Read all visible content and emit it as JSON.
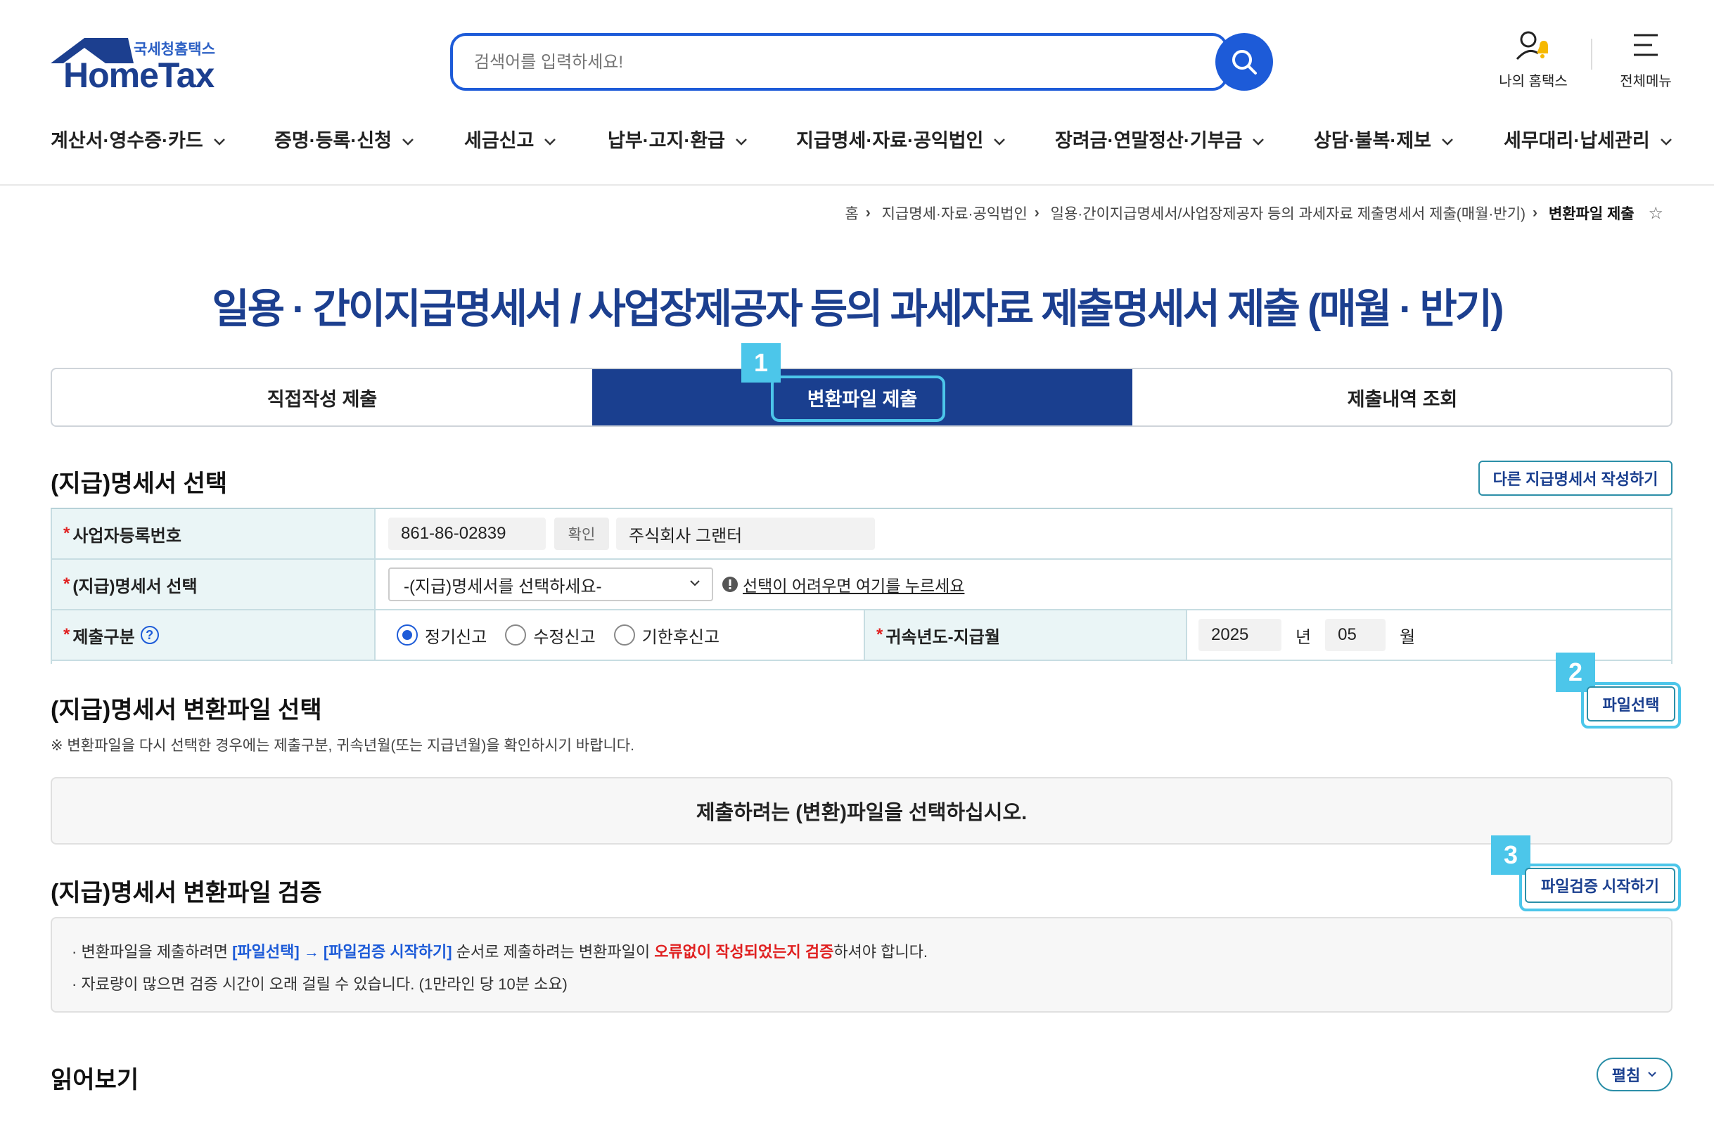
{
  "header": {
    "logo_sub": "국세청홈택스",
    "logo_main": "HomeTax",
    "search_placeholder": "검색어를 입력하세요!",
    "my_hometax": "나의 홈택스",
    "all_menu": "전체메뉴"
  },
  "gnb": [
    "계산서·영수증·카드",
    "증명·등록·신청",
    "세금신고",
    "납부·고지·환급",
    "지급명세·자료·공익법인",
    "장려금·연말정산·기부금",
    "상담·불복·제보",
    "세무대리·납세관리"
  ],
  "breadcrumb": {
    "home": "홈",
    "level1": "지급명세·자료·공익법인",
    "level2": "일용·간이지급명세서/사업장제공자 등의 과세자료 제출명세서 제출(매월·반기)",
    "current": "변환파일 제출"
  },
  "page_title": "일용 · 간이지급명세서 / 사업장제공자 등의 과세자료 제출명세서 제출 (매월 · 반기)",
  "tabs": [
    "직접작성 제출",
    "변환파일 제출",
    "제출내역 조회"
  ],
  "markers": [
    "1",
    "2",
    "3"
  ],
  "section1": {
    "title": "(지급)명세서 선택",
    "other_btn": "다른 지급명세서 작성하기",
    "biz_no_label": "사업자등록번호",
    "biz_no": "861-86-02839",
    "confirm_btn": "확인",
    "company": "주식회사 그랜터",
    "stmt_label": "(지급)명세서 선택",
    "stmt_select": "-(지급)명세서를 선택하세요-",
    "stmt_help": "선택이 어려우면 여기를 누르세요",
    "submit_type_label": "제출구분",
    "help_icon": "?",
    "radio_options": [
      "정기신고",
      "수정신고",
      "기한후신고"
    ],
    "period_label": "귀속년도-지급월",
    "year": "2025",
    "year_unit": "년",
    "month": "05",
    "month_unit": "월"
  },
  "section2": {
    "title": "(지급)명세서 변환파일 선택",
    "file_btn": "파일선택",
    "note": "※ 변환파일을 다시 선택한 경우에는 제출구분, 귀속년월(또는 지급년월)을 확인하시기 바랍니다.",
    "empty_msg": "제출하려는 (변환)파일을 선택하십시오."
  },
  "section3": {
    "title": "(지급)명세서 변환파일 검증",
    "verify_btn": "파일검증 시작하기",
    "line1_a": "변환파일을 제출하려면 ",
    "line1_b": "[파일선택] → [파일검증 시작하기]",
    "line1_c": " 순서로 제출하려는 변환파일이 ",
    "line1_d": "오류없이 작성되었는지 검증",
    "line1_e": "하셔야 합니다.",
    "line2": "자료량이 많으면 검증 시간이 오래 걸릴 수 있습니다. (1만라인 당 10분 소요)"
  },
  "section4": {
    "title": "읽어보기",
    "fold_btn": "펼침"
  },
  "colors": {
    "brand_navy": "#1a3f8f",
    "search_blue": "#1d5bd8",
    "highlight_cyan": "#4cc6ea",
    "required_red": "#e02020"
  }
}
